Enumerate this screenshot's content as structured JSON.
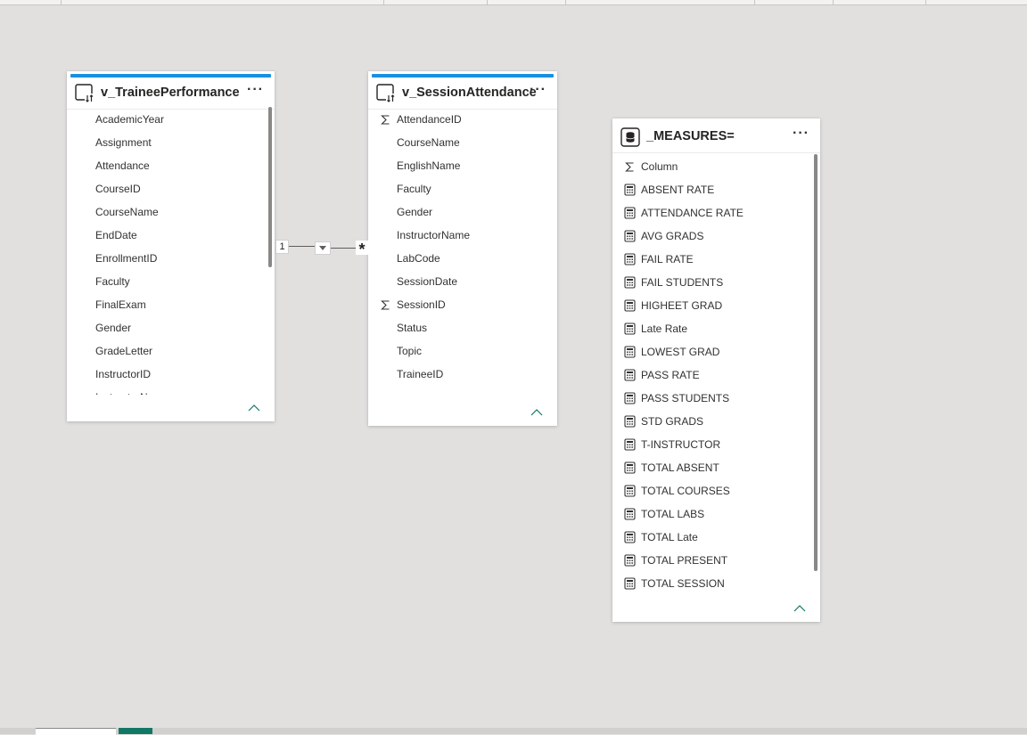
{
  "colors": {
    "canvas": "#e1e0df",
    "accent": "#1890e0",
    "card_bg": "#ffffff",
    "active_page_tab": "#117865"
  },
  "tables": [
    {
      "name": "v_TraineePerformance",
      "icon": "table-icon",
      "more_label": "···",
      "fields": [
        {
          "name": "AcademicYear",
          "icon": ""
        },
        {
          "name": "Assignment",
          "icon": ""
        },
        {
          "name": "Attendance",
          "icon": ""
        },
        {
          "name": "CourseID",
          "icon": ""
        },
        {
          "name": "CourseName",
          "icon": ""
        },
        {
          "name": "EndDate",
          "icon": ""
        },
        {
          "name": "EnrollmentID",
          "icon": ""
        },
        {
          "name": "Faculty",
          "icon": ""
        },
        {
          "name": "FinalExam",
          "icon": ""
        },
        {
          "name": "Gender",
          "icon": ""
        },
        {
          "name": "GradeLetter",
          "icon": ""
        },
        {
          "name": "InstructorID",
          "icon": ""
        },
        {
          "name": "InstructorName",
          "icon": ""
        }
      ]
    },
    {
      "name": "v_SessionAttendance",
      "icon": "table-icon",
      "more_label": "···",
      "fields": [
        {
          "name": "AttendanceID",
          "icon": "sigma-icon"
        },
        {
          "name": "CourseName",
          "icon": ""
        },
        {
          "name": "EnglishName",
          "icon": ""
        },
        {
          "name": "Faculty",
          "icon": ""
        },
        {
          "name": "Gender",
          "icon": ""
        },
        {
          "name": "InstructorName",
          "icon": ""
        },
        {
          "name": "LabCode",
          "icon": ""
        },
        {
          "name": "SessionDate",
          "icon": ""
        },
        {
          "name": "SessionID",
          "icon": "sigma-icon"
        },
        {
          "name": "Status",
          "icon": ""
        },
        {
          "name": "Topic",
          "icon": ""
        },
        {
          "name": "TraineeID",
          "icon": ""
        }
      ]
    },
    {
      "name": "_MEASURES=",
      "icon": "measure-table-icon",
      "more_label": "···",
      "fields": [
        {
          "name": "Column",
          "icon": "sigma-icon"
        },
        {
          "name": "ABSENT RATE",
          "icon": "calculator-icon"
        },
        {
          "name": "ATTENDANCE RATE",
          "icon": "calculator-icon"
        },
        {
          "name": "AVG GRADS",
          "icon": "calculator-icon"
        },
        {
          "name": "FAIL RATE",
          "icon": "calculator-icon"
        },
        {
          "name": "FAIL STUDENTS",
          "icon": "calculator-icon"
        },
        {
          "name": "HIGHEET GRAD",
          "icon": "calculator-icon"
        },
        {
          "name": "Late Rate",
          "icon": "calculator-icon"
        },
        {
          "name": "LOWEST GRAD",
          "icon": "calculator-icon"
        },
        {
          "name": "PASS RATE",
          "icon": "calculator-icon"
        },
        {
          "name": "PASS STUDENTS",
          "icon": "calculator-icon"
        },
        {
          "name": "STD GRADS",
          "icon": "calculator-icon"
        },
        {
          "name": "T-INSTRUCTOR",
          "icon": "calculator-icon"
        },
        {
          "name": "TOTAL ABSENT",
          "icon": "calculator-icon"
        },
        {
          "name": "TOTAL COURSES",
          "icon": "calculator-icon"
        },
        {
          "name": "TOTAL LABS",
          "icon": "calculator-icon"
        },
        {
          "name": "TOTAL Late",
          "icon": "calculator-icon"
        },
        {
          "name": "TOTAL PRESENT",
          "icon": "calculator-icon"
        },
        {
          "name": "TOTAL SESSION",
          "icon": "calculator-icon"
        }
      ]
    }
  ],
  "relationship": {
    "from_cardinality": "1",
    "to_cardinality": "*",
    "filter_direction": "single"
  }
}
